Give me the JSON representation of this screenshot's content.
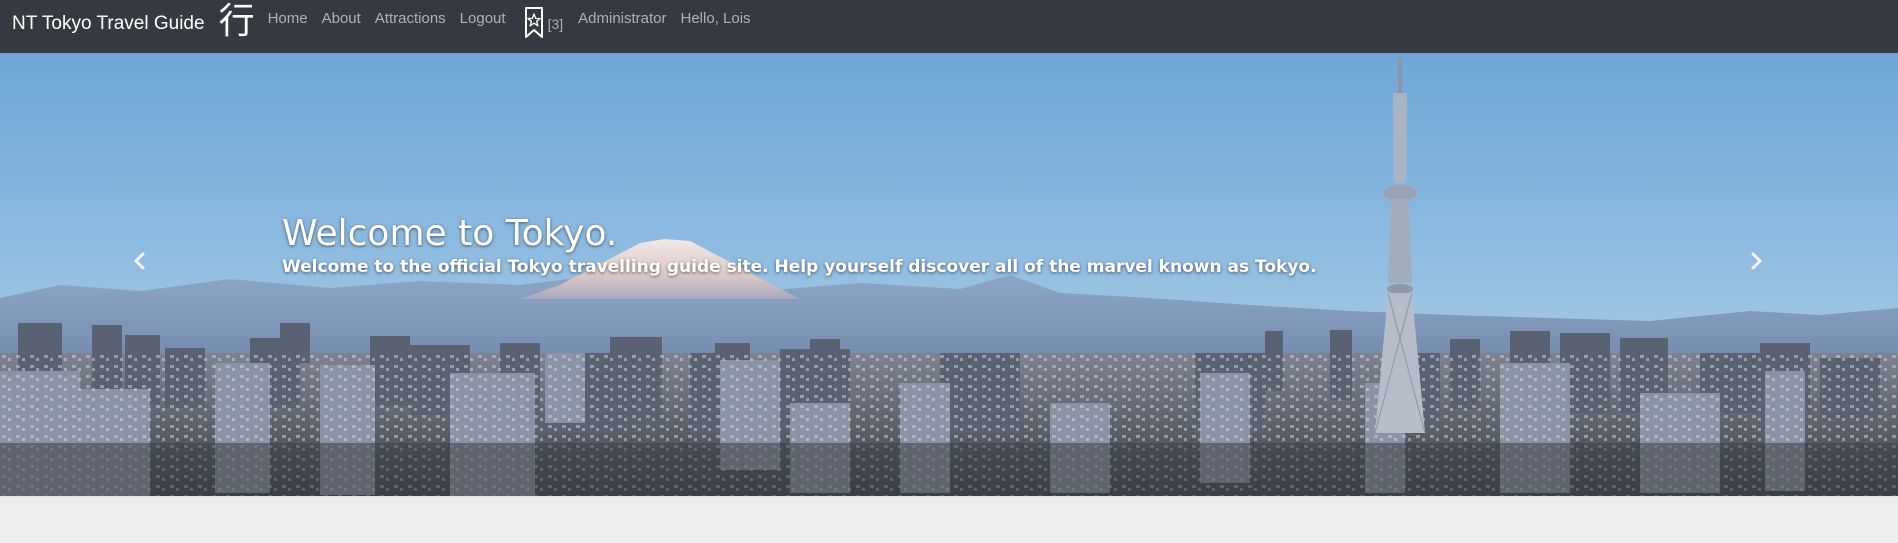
{
  "navbar": {
    "brand": "NT Tokyo Travel Guide",
    "brand_glyph": "行",
    "links": [
      "Home",
      "About",
      "Attractions",
      "Logout"
    ],
    "bookmark_icon": "bookmark-star-icon",
    "bookmark_count": "[3]",
    "admin_link": "Administrator",
    "greeting": "Hello, Lois",
    "background": "#343a40"
  },
  "carousel": {
    "title": "Welcome to Tokyo.",
    "subtitle": "Welcome to the official Tokyo travelling guide site. Help yourself discover all of the marvel known as Tokyo.",
    "prev_icon": "chevron-left-icon",
    "next_icon": "chevron-right-icon"
  }
}
